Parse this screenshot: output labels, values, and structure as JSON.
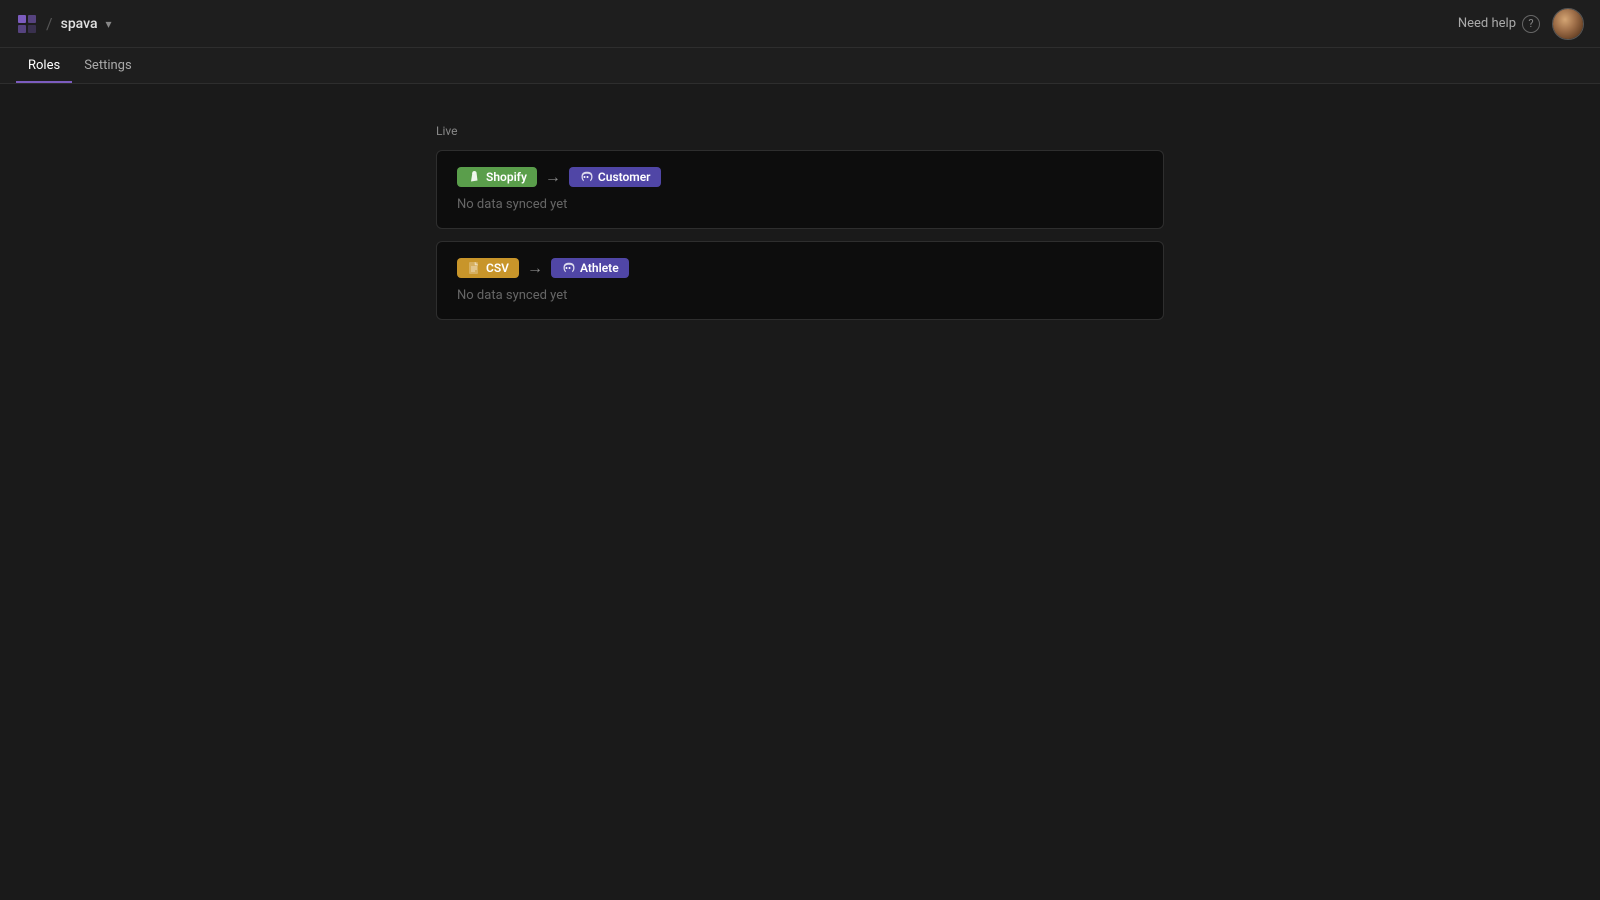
{
  "header": {
    "logo_label": "spava",
    "separator": "/",
    "dropdown_symbol": "▾",
    "need_help_label": "Need help",
    "help_icon": "?",
    "project_name": "spava"
  },
  "nav": {
    "tabs": [
      {
        "id": "roles",
        "label": "Roles",
        "active": true
      },
      {
        "id": "settings",
        "label": "Settings",
        "active": false
      }
    ]
  },
  "main": {
    "section_label": "Live",
    "sync_cards": [
      {
        "id": "shopify-customer",
        "source": "Shopify",
        "source_type": "shopify",
        "destination": "Customer",
        "destination_type": "discord",
        "status_text": "No data synced yet"
      },
      {
        "id": "csv-athlete",
        "source": "CSV",
        "source_type": "csv",
        "destination": "Athlete",
        "destination_type": "discord",
        "status_text": "No data synced yet"
      }
    ]
  }
}
